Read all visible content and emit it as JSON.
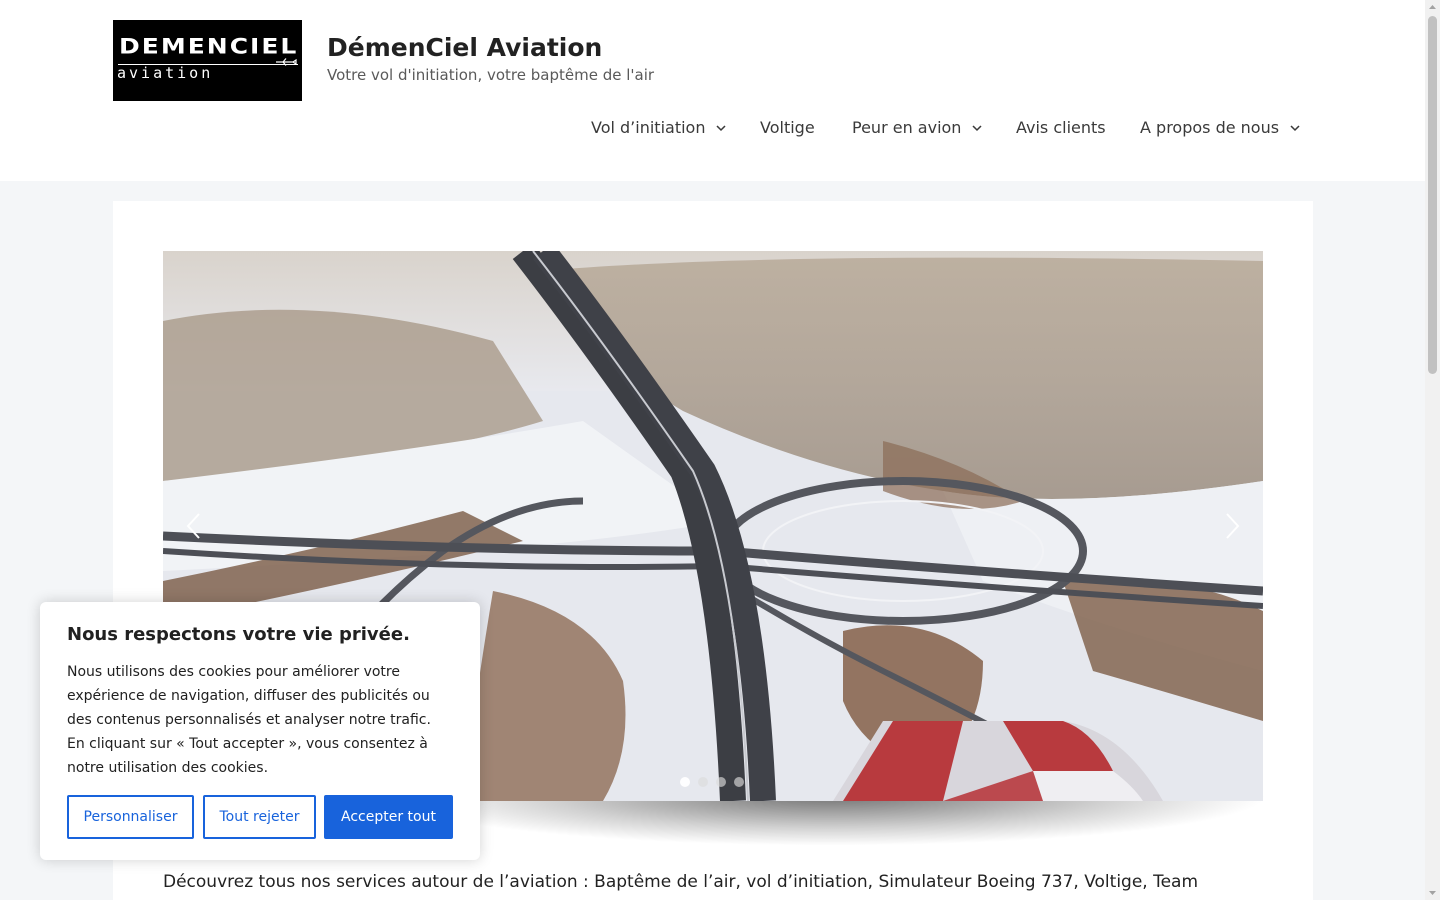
{
  "header": {
    "logo": {
      "top": "DEMENCIEL",
      "bottom": "aviation"
    },
    "site_title": "DémenCiel Aviation",
    "tagline": "Votre vol d'initiation, votre baptême de l'air"
  },
  "nav": {
    "items": [
      {
        "label": "Vol d’initiation",
        "has_dropdown": true
      },
      {
        "label": "Voltige",
        "has_dropdown": false
      },
      {
        "label": "Peur en avion",
        "has_dropdown": true
      },
      {
        "label": "Avis clients",
        "has_dropdown": false
      },
      {
        "label": "A propos de nous",
        "has_dropdown": true
      }
    ]
  },
  "slider": {
    "slide_count": 4,
    "active_slide": 1,
    "prev_icon": "chevron-left-icon",
    "next_icon": "chevron-right-icon"
  },
  "content": {
    "intro": "Découvrez tous nos services autour de l’aviation : Baptême de l’air, vol d’initiation, Simulateur Boeing 737, Voltige, Team"
  },
  "cookie": {
    "title": "Nous respectons votre vie privée.",
    "body": "Nous utilisons des cookies pour améliorer votre expérience de navigation, diffuser des publicités ou des contenus personnalisés et analyser notre trafic. En cliquant sur « Tout accepter », vous consentez à notre utilisation des cookies.",
    "customize_label": "Personnaliser",
    "reject_label": "Tout rejeter",
    "accept_label": "Accepter tout"
  },
  "colors": {
    "accent": "#1863dc",
    "page_bg": "#f4f6f8",
    "header_bg": "#ffffff",
    "text": "#222222"
  }
}
